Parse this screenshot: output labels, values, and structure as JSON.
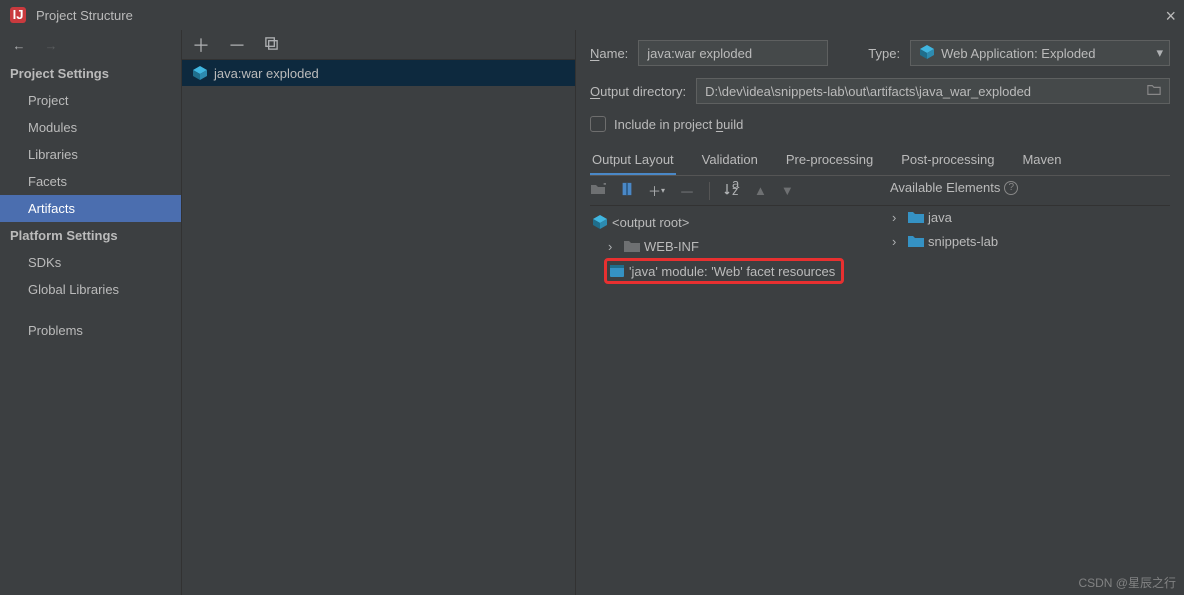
{
  "window": {
    "title": "Project Structure"
  },
  "sidebar": {
    "sections": [
      {
        "title": "Project Settings",
        "items": [
          "Project",
          "Modules",
          "Libraries",
          "Facets",
          "Artifacts"
        ]
      },
      {
        "title": "Platform Settings",
        "items": [
          "SDKs",
          "Global Libraries"
        ]
      }
    ],
    "problems": "Problems",
    "selected": "Artifacts"
  },
  "middle": {
    "item": "java:war exploded"
  },
  "form": {
    "name_label": "Name:",
    "name_value": "java:war exploded",
    "type_label": "Type:",
    "type_value": "Web Application: Exploded",
    "output_label": "Output directory:",
    "output_value": "D:\\dev\\idea\\snippets-lab\\out\\artifacts\\java_war_exploded",
    "include_label_pre": "Include in project ",
    "include_label_u": "b",
    "include_label_post": "uild"
  },
  "tabs": [
    "Output Layout",
    "Validation",
    "Pre-processing",
    "Post-processing",
    "Maven"
  ],
  "tree": {
    "root": "<output root>",
    "webinf": "WEB-INF",
    "facet": "'java' module: 'Web' facet resources"
  },
  "available": {
    "title": "Available Elements",
    "items": [
      "java",
      "snippets-lab"
    ]
  },
  "watermark": "CSDN @星辰之行"
}
